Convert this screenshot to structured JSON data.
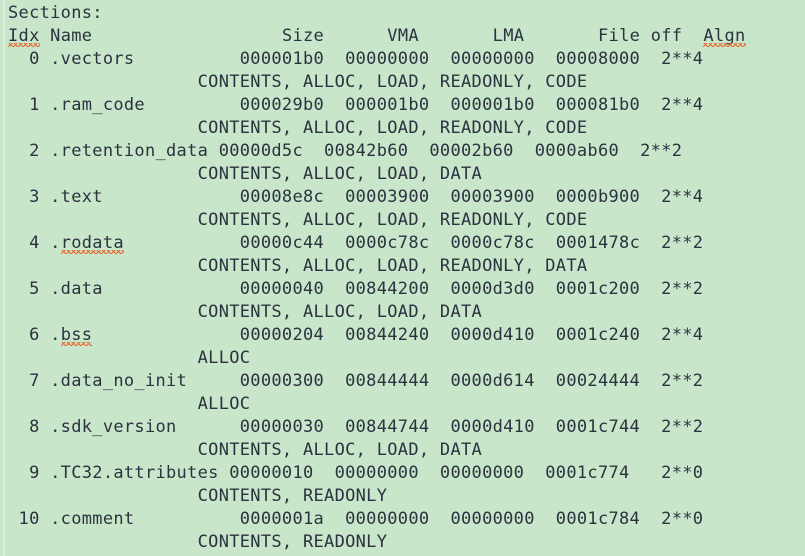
{
  "document": {
    "background_color": "#c8e6c9",
    "text_color": "#2b3240",
    "spellcheck_underline_color": "#e8622c",
    "title_line": "Sections:"
  },
  "table": {
    "header": {
      "idx": "Idx",
      "name": "Name",
      "size": "Size",
      "vma": "VMA",
      "lma": "LMA",
      "file_off": "File off",
      "algn": "Algn",
      "raw": "Idx Name                  Size      VMA       LMA       File off  Algn"
    },
    "misspelled_words": [
      "Idx",
      "Algn",
      "rodata",
      "bss"
    ],
    "rows": [
      {
        "idx": "0",
        "name": ".vectors",
        "size": "000001b0",
        "vma": "00000000",
        "lma": "00000000",
        "file_off": "00008000",
        "algn": "2**4",
        "flags": "CONTENTS, ALLOC, LOAD, READONLY, CODE",
        "raw": "  0 .vectors          000001b0  00000000  00000000  00008000  2**4",
        "flags_raw": "                  CONTENTS, ALLOC, LOAD, READONLY, CODE"
      },
      {
        "idx": "1",
        "name": ".ram_code",
        "size": "000029b0",
        "vma": "000001b0",
        "lma": "000001b0",
        "file_off": "000081b0",
        "algn": "2**4",
        "flags": "CONTENTS, ALLOC, LOAD, READONLY, CODE",
        "raw": "  1 .ram_code         000029b0  000001b0  000001b0  000081b0  2**4",
        "flags_raw": "                  CONTENTS, ALLOC, LOAD, READONLY, CODE"
      },
      {
        "idx": "2",
        "name": ".retention_data",
        "size": "00000d5c",
        "vma": "00842b60",
        "lma": "00002b60",
        "file_off": "0000ab60",
        "algn": "2**2",
        "flags": "CONTENTS, ALLOC, LOAD, DATA",
        "raw": "  2 .retention_data 00000d5c  00842b60  00002b60  0000ab60  2**2",
        "flags_raw": "                  CONTENTS, ALLOC, LOAD, DATA"
      },
      {
        "idx": "3",
        "name": ".text",
        "size": "00008e8c",
        "vma": "00003900",
        "lma": "00003900",
        "file_off": "0000b900",
        "algn": "2**4",
        "flags": "CONTENTS, ALLOC, LOAD, READONLY, CODE",
        "raw": "  3 .text             00008e8c  00003900  00003900  0000b900  2**4",
        "flags_raw": "                  CONTENTS, ALLOC, LOAD, READONLY, CODE"
      },
      {
        "idx": "4",
        "name": ".rodata",
        "size": "00000c44",
        "vma": "0000c78c",
        "lma": "0000c78c",
        "file_off": "0001478c",
        "algn": "2**2",
        "flags": "CONTENTS, ALLOC, LOAD, READONLY, DATA",
        "raw_prefix": "  4 ",
        "raw_name": ".rodata",
        "raw_suffix": "           00000c44  0000c78c  0000c78c  0001478c  2**2",
        "flags_raw": "                  CONTENTS, ALLOC, LOAD, READONLY, DATA"
      },
      {
        "idx": "5",
        "name": ".data",
        "size": "00000040",
        "vma": "00844200",
        "lma": "0000d3d0",
        "file_off": "0001c200",
        "algn": "2**2",
        "flags": "CONTENTS, ALLOC, LOAD, DATA",
        "raw": "  5 .data             00000040  00844200  0000d3d0  0001c200  2**2",
        "flags_raw": "                  CONTENTS, ALLOC, LOAD, DATA"
      },
      {
        "idx": "6",
        "name": ".bss",
        "size": "00000204",
        "vma": "00844240",
        "lma": "0000d410",
        "file_off": "0001c240",
        "algn": "2**4",
        "flags": "ALLOC",
        "raw_prefix": "  6 ",
        "raw_name": ".bss",
        "raw_suffix": "              00000204  00844240  0000d410  0001c240  2**4",
        "flags_raw": "                  ALLOC"
      },
      {
        "idx": "7",
        "name": ".data_no_init",
        "size": "00000300",
        "vma": "00844444",
        "lma": "0000d614",
        "file_off": "00024444",
        "algn": "2**2",
        "flags": "ALLOC",
        "raw": "  7 .data_no_init     00000300  00844444  0000d614  00024444  2**2",
        "flags_raw": "                  ALLOC"
      },
      {
        "idx": "8",
        "name": ".sdk_version",
        "size": "00000030",
        "vma": "00844744",
        "lma": "0000d410",
        "file_off": "0001c744",
        "algn": "2**2",
        "flags": "CONTENTS, ALLOC, LOAD, DATA",
        "raw": "  8 .sdk_version      00000030  00844744  0000d410  0001c744  2**2",
        "flags_raw": "                  CONTENTS, ALLOC, LOAD, DATA"
      },
      {
        "idx": "9",
        "name": ".TC32.attributes",
        "size": "00000010",
        "vma": "00000000",
        "lma": "00000000",
        "file_off": "0001c774",
        "algn": "2**0",
        "flags": "CONTENTS, READONLY",
        "raw": "  9 .TC32.attributes 00000010  00000000  00000000  0001c774   2**0",
        "flags_raw": "                  CONTENTS, READONLY"
      },
      {
        "idx": "10",
        "name": ".comment",
        "size": "0000001a",
        "vma": "00000000",
        "lma": "00000000",
        "file_off": "0001c784",
        "algn": "2**0",
        "flags": "CONTENTS, READONLY",
        "raw": " 10 .comment          0000001a  00000000  00000000  0001c784  2**0",
        "flags_raw": "                  CONTENTS, READONLY"
      }
    ]
  }
}
